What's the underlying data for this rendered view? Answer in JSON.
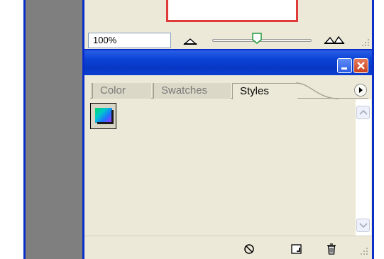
{
  "navigator": {
    "zoom_value": "100%",
    "zoom_slider_position": 0.45
  },
  "palette": {
    "tabs": [
      {
        "label": "Color",
        "active": false
      },
      {
        "label": "Swatches",
        "active": false
      },
      {
        "label": "Styles",
        "active": true
      }
    ],
    "styles": [
      {
        "name": "gradient-style"
      }
    ],
    "icons": {
      "minimize": "minimize-icon",
      "close": "close-icon",
      "menu": "palette-menu-icon",
      "clear": "clear-style-icon",
      "new": "new-style-icon",
      "delete": "trash-icon"
    }
  },
  "colors": {
    "titlebar": "#0b43d6",
    "frame": "#0a2fc9",
    "panel": "#ece9d8"
  }
}
